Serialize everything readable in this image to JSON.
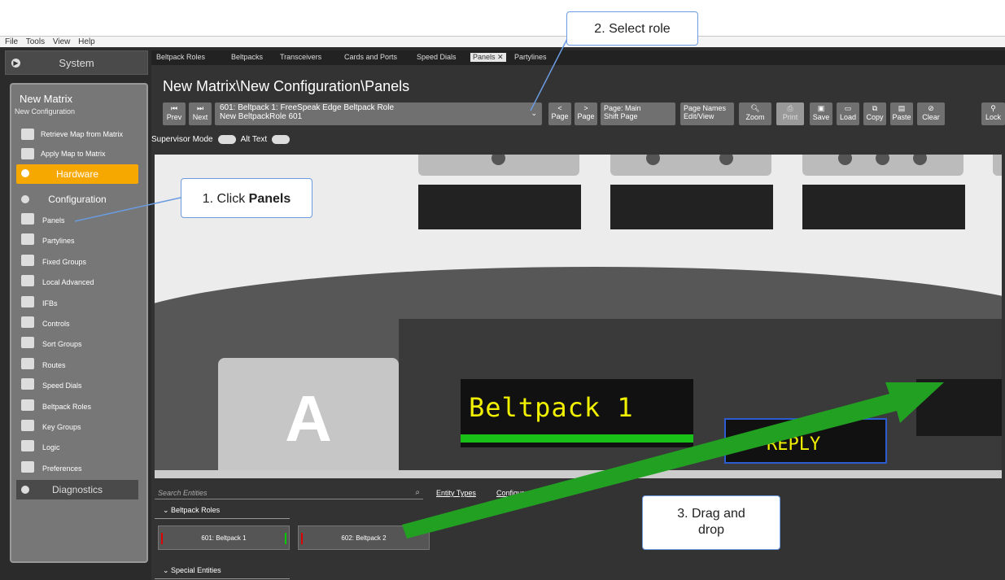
{
  "menu": [
    "File",
    "Tools",
    "View",
    "Help"
  ],
  "sidebar": {
    "system": "System",
    "matrix_title": "New Matrix",
    "config_name": "New Configuration",
    "actions": [
      "Retrieve Map from Matrix",
      "Apply Map to Matrix"
    ],
    "hardware": "Hardware",
    "configuration": "Configuration",
    "items": [
      "Panels",
      "Partylines",
      "Fixed Groups",
      "Local Advanced",
      "IFBs",
      "Controls",
      "Sort Groups",
      "Routes",
      "Speed Dials",
      "Beltpack Roles",
      "Key Groups",
      "Logic",
      "Preferences"
    ],
    "diagnostics": "Diagnostics"
  },
  "tabs": [
    "Beltpack Roles",
    "Beltpacks",
    "Transceivers",
    "Cards and Ports",
    "Speed Dials",
    "Panels ✕",
    "Partylines"
  ],
  "path": "New Matrix\\New Configuration\\Panels",
  "toolbar": {
    "prev": "Prev",
    "next": "Next",
    "role_line1": "601: Beltpack 1: FreeSpeak Edge Beltpack Role",
    "role_line2": "New BeltpackRole 601",
    "page_back": "Page",
    "page_fwd": "Page",
    "page_main": "Page: Main",
    "shift_page": "Shift Page",
    "page_names": "Page Names",
    "edit_view": "Edit/View",
    "zoom": "Zoom",
    "print": "Print",
    "save": "Save",
    "load": "Load",
    "copy": "Copy",
    "paste": "Paste",
    "clear": "Clear",
    "lock": "Lock"
  },
  "supervisor_mode": "Supervisor Mode",
  "alt_text": "Alt Text",
  "panel": {
    "key_a": "A",
    "lcd_label": "Beltpack 1",
    "lcd_reply": "REPLY"
  },
  "bottom": {
    "search_placeholder": "Search Entities",
    "entity_types": "Entity Types",
    "configure": "Configure Pa",
    "sections": [
      "Beltpack Roles",
      "Special Entities"
    ],
    "entities": [
      "601: Beltpack 1",
      "602: Beltpack 2"
    ]
  },
  "callouts": {
    "step1_prefix": "1. Click ",
    "step1_bold": "Panels",
    "step2": "2. Select role",
    "step3": "3. Drag and drop"
  },
  "colors": {
    "hardware": "#f7a800",
    "lcd_text": "#f0f000",
    "lcd_bar": "#18c018",
    "drag_arrow": "#22a022",
    "callout_border": "#6b9be0"
  }
}
